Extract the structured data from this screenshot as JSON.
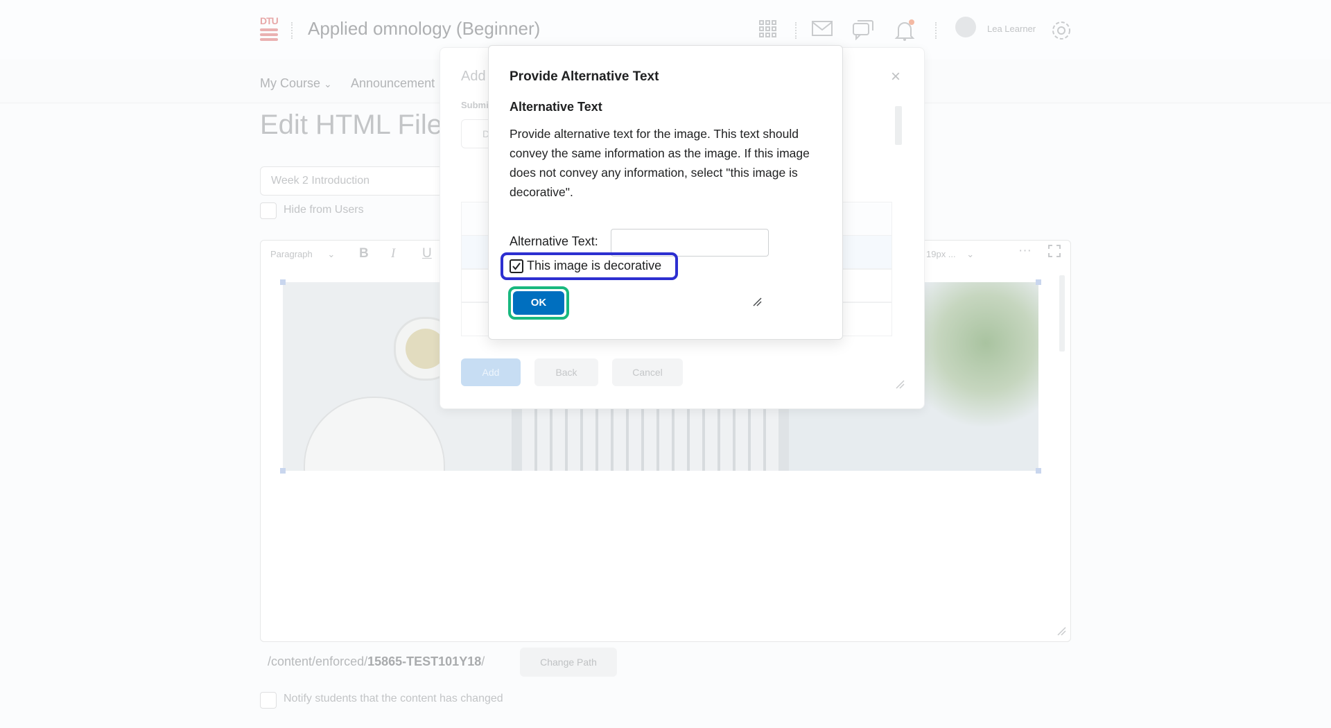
{
  "header": {
    "logo_text": "DTU",
    "course_title": "Applied omnology (Beginner)",
    "user_name": "Lea Learner"
  },
  "nav": {
    "items": [
      "My Course",
      "Announcement"
    ]
  },
  "page": {
    "title": "Edit HTML File",
    "title_input_value": "Week 2 Introduction",
    "hide_from_users_label": "Hide from Users",
    "notify_label": "Notify students that the content has changed",
    "path_prefix": "/content/enforced/",
    "path_bold": "15865-TEST101Y18",
    "path_suffix": "/",
    "change_path_label": "Change Path"
  },
  "editor_toolbar": {
    "format_label": "Paragraph",
    "bold": "B",
    "italic": "I",
    "underline": "U",
    "font_size": "19px ...",
    "more": "···"
  },
  "back_dialog": {
    "title": "Add",
    "field_label": "Submi",
    "field_value": "D",
    "add_label": "Add",
    "back_label": "Back",
    "cancel_label": "Cancel",
    "close": "×"
  },
  "dialog": {
    "title": "Provide Alternative Text",
    "heading": "Alternative Text",
    "description": "Provide alternative text for the image. This text should convey the same information as the image. If this image does not convey any information, select \"this image is decorative\".",
    "alt_text_label": "Alternative Text:",
    "alt_text_value": "",
    "decorative_label": "This image is decorative",
    "decorative_checked": true,
    "ok_label": "OK"
  },
  "colors": {
    "ok_button": "#006fbf",
    "focus_ring": "#2d2fd0",
    "ok_focus_ring": "#18b87f"
  }
}
